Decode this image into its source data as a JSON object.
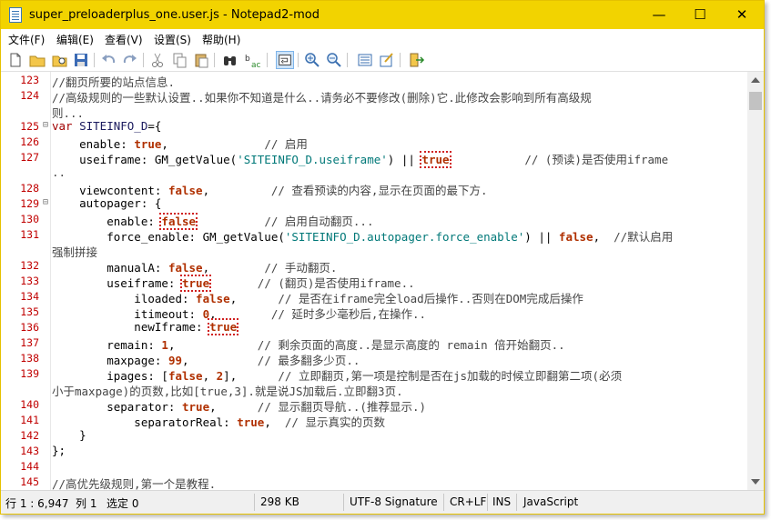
{
  "window": {
    "title": "super_preloaderplus_one.user.js - Notepad2-mod",
    "accent": "#f2d300"
  },
  "controls": {
    "minimize": "—",
    "maximize": "☐",
    "close": "✕"
  },
  "menu": {
    "file": "文件(F)",
    "edit": "编辑(E)",
    "view": "查看(V)",
    "settings": "设置(S)",
    "help": "帮助(H)"
  },
  "toolbar": {
    "buttons": [
      "new-file",
      "open-file",
      "browse",
      "save",
      "undo",
      "redo",
      "cut",
      "copy",
      "paste",
      "find",
      "replace",
      "word-wrap",
      "zoom-in",
      "zoom-out",
      "scheme",
      "customize",
      "exit"
    ]
  },
  "editor": {
    "line_numbers": [
      "123",
      "124",
      "",
      "125",
      "126",
      "127",
      "",
      "128",
      "129",
      "130",
      "131",
      "",
      "132",
      "133",
      "134",
      "135",
      "136",
      "137",
      "138",
      "139",
      "",
      "140",
      "141",
      "142",
      "143",
      "144",
      "145"
    ],
    "lines": [
      {
        "seg": [
          [
            "cmt",
            "//翻页所要的站点信息."
          ]
        ]
      },
      {
        "seg": [
          [
            "cmt",
            "//高级规则的一些默认设置..如果你不知道是什么..请务必不要修改(删除)它.此修改会影响到所有高级规"
          ]
        ]
      },
      {
        "seg": [
          [
            "cmt",
            "则..."
          ]
        ]
      },
      {
        "seg": [
          [
            "kw",
            "var"
          ],
          [
            "id",
            " SITEINFO_D"
          ],
          [
            "",
            "={"
          ]
        ]
      },
      {
        "seg": [
          [
            "",
            "    enable: "
          ],
          [
            "val",
            "true"
          ],
          [
            "",
            ",              "
          ],
          [
            "cmt",
            "// 启用"
          ]
        ]
      },
      {
        "seg": [
          [
            "",
            "    useiframe: GM_getValue("
          ],
          [
            "str",
            "'SITEINFO_D.useiframe'"
          ],
          [
            "",
            ") || "
          ],
          [
            "valm",
            "true"
          ],
          [
            "",
            "           "
          ],
          [
            "cmt",
            "// (预读)是否使用iframe"
          ]
        ]
      },
      {
        "seg": [
          [
            "cmt",
            ".."
          ]
        ]
      },
      {
        "seg": [
          [
            "",
            "    viewcontent: "
          ],
          [
            "val",
            "false"
          ],
          [
            "",
            ",         "
          ],
          [
            "cmt",
            "// 查看预读的内容,显示在页面的最下方."
          ]
        ]
      },
      {
        "seg": [
          [
            "",
            "    autopager: {"
          ]
        ]
      },
      {
        "seg": [
          [
            "",
            "        enable: "
          ],
          [
            "valm",
            "false"
          ],
          [
            "",
            "          "
          ],
          [
            "cmt",
            "// 启用自动翻页..."
          ]
        ]
      },
      {
        "seg": [
          [
            "",
            "        force_enable: GM_getValue("
          ],
          [
            "str",
            "'SITEINFO_D.autopager.force_enable'"
          ],
          [
            "",
            ") || "
          ],
          [
            "val",
            "false"
          ],
          [
            "",
            ",  "
          ],
          [
            "cmt",
            "//默认启用"
          ]
        ]
      },
      {
        "seg": [
          [
            "cmt",
            "强制拼接"
          ]
        ]
      },
      {
        "seg": [
          [
            "",
            "        manualA: "
          ],
          [
            "val",
            "false"
          ],
          [
            "",
            ",        "
          ],
          [
            "cmt",
            "// 手动翻页."
          ]
        ]
      },
      {
        "seg": [
          [
            "",
            "        useiframe: "
          ],
          [
            "valm",
            "true"
          ],
          [
            "",
            "       "
          ],
          [
            "cmt",
            "// (翻页)是否使用iframe.."
          ]
        ]
      },
      {
        "seg": [
          [
            "",
            "            iloaded: "
          ],
          [
            "val",
            "false"
          ],
          [
            "",
            ",      "
          ],
          [
            "cmt",
            "// 是否在iframe完全load后操作..否则在DOM完成后操作"
          ]
        ]
      },
      {
        "seg": [
          [
            "",
            "            itimeout: "
          ],
          [
            "val",
            "0"
          ],
          [
            "",
            ",        "
          ],
          [
            "cmt",
            "// 延时多少毫秒后,在操作.."
          ]
        ]
      },
      {
        "seg": [
          [
            "",
            "            newIframe: "
          ],
          [
            "valm",
            "true"
          ]
        ]
      },
      {
        "seg": [
          [
            "",
            "        remain: "
          ],
          [
            "val",
            "1"
          ],
          [
            "",
            ",            "
          ],
          [
            "cmt",
            "// 剩余页面的高度..是显示高度的 remain 倍开始翻页.."
          ]
        ]
      },
      {
        "seg": [
          [
            "",
            "        maxpage: "
          ],
          [
            "val",
            "99"
          ],
          [
            "",
            ",          "
          ],
          [
            "cmt",
            "// 最多翻多少页.."
          ]
        ]
      },
      {
        "seg": [
          [
            "",
            "        ipages: ["
          ],
          [
            "val",
            "false"
          ],
          [
            "",
            ", "
          ],
          [
            "val",
            "2"
          ],
          [
            "",
            "],      "
          ],
          [
            "cmt",
            "// 立即翻页,第一项是控制是否在js加载的时候立即翻第二项(必须"
          ]
        ]
      },
      {
        "seg": [
          [
            "cmt",
            "小于maxpage)的页数,比如[true,3].就是说JS加载后.立即翻3页."
          ]
        ]
      },
      {
        "seg": [
          [
            "",
            "        separator: "
          ],
          [
            "val",
            "true"
          ],
          [
            "",
            ",      "
          ],
          [
            "cmt",
            "// 显示翻页导航..(推荐显示.)"
          ]
        ]
      },
      {
        "seg": [
          [
            "",
            "            separatorReal: "
          ],
          [
            "val",
            "true"
          ],
          [
            "",
            ",  "
          ],
          [
            "cmt",
            "// 显示真实的页数"
          ]
        ]
      },
      {
        "seg": [
          [
            "",
            "    }"
          ]
        ]
      },
      {
        "seg": [
          [
            "",
            "};"
          ]
        ]
      },
      {
        "seg": []
      },
      {
        "seg": [
          [
            "cmt",
            "//高优先级规则,第一个是教程."
          ]
        ]
      }
    ],
    "folds": [
      "",
      "",
      "",
      "⊟",
      "",
      "",
      "",
      "",
      "⊟",
      "",
      "",
      "",
      "",
      "",
      "",
      "",
      "",
      "",
      "",
      "",
      "",
      "",
      "",
      "",
      "",
      "",
      ""
    ]
  },
  "status": {
    "position": "行 1 : 6,947",
    "column": "列 1",
    "selection": "选定 0",
    "size": "298 KB",
    "encoding": "UTF-8 Signature",
    "eol": "CR+LF",
    "mode": "INS",
    "lexer": "JavaScript"
  }
}
